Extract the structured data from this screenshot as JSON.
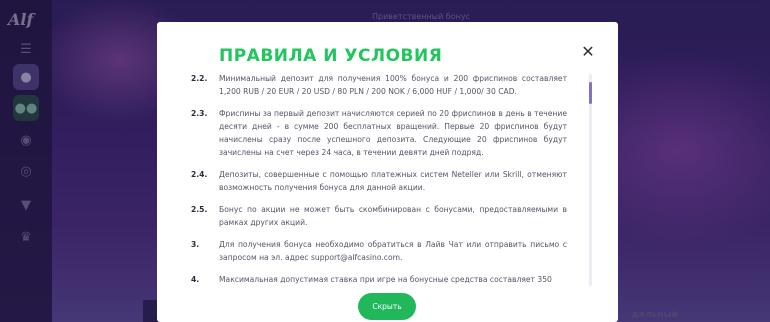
{
  "background": {
    "promo_title": "Приветственный бонус",
    "bottom_label": "дельный"
  },
  "sidebar": {
    "logo": "Alf",
    "icons": [
      "menu-icon",
      "user-add-icon",
      "users-icon",
      "gamepad-icon",
      "bitcoin-icon",
      "trophy-icon",
      "crown-icon"
    ]
  },
  "modal": {
    "title": "ПРАВИЛА И УСЛОВИЯ",
    "close_label": "✕",
    "rules": [
      {
        "num": "2.2.",
        "text": "Минимальный депозит для получения 100% бонуса и 200 фриспинов составляет 1,200 RUB / 20 EUR / 20 USD / 80 PLN / 200 NOK / 6,000 HUF / 1,000/ 30 CAD."
      },
      {
        "num": "2.3.",
        "text": "Фриспины за первый депозит начисляются серией по 20 фриспинов в день в течение десяти дней - в сумме 200 бесплатных вращений. Первые 20 фриспинов будут начислены сразу после успешного депозита. Следующие 20 фриспинов будут зачислены на счет через 24 часа, в течении девяти дней подряд."
      },
      {
        "num": "2.4.",
        "text": "Депозиты, совершенные с помощью платежных систем Neteller или Skrill, отменяют возможность получения бонуса для данной акции."
      },
      {
        "num": "2.5.",
        "text": "Бонус по акции не может быть скомбинирован с бонусами, предоставляемыми в рамках других акций."
      },
      {
        "num": "3.",
        "text": "Для получения бонуса необходимо обратиться в Лайв Чат или отправить письмо с запросом на эл. адрес support@alfcasino.com."
      },
      {
        "num": "4.",
        "text": "Максимальная допустимая ставка при игре на бонусные средства составляет 350"
      }
    ],
    "hide_button": "Скрыть"
  }
}
